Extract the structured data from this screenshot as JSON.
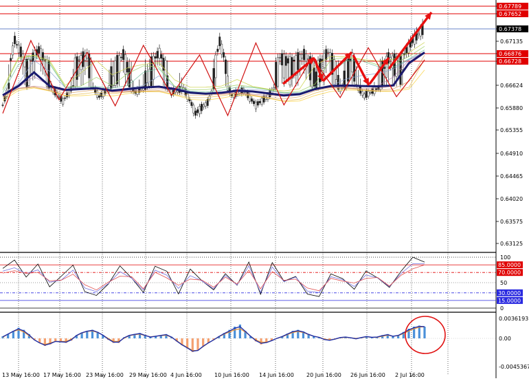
{
  "chart_data": [
    {
      "type": "candlestick",
      "title": "",
      "instrument_note": "",
      "y_ticks": [
        "0.67789",
        "0.67652",
        "0.67378",
        "0.67135",
        "0.66876",
        "0.66728",
        "0.66624",
        "0.65880",
        "0.65355",
        "0.64910",
        "0.64465",
        "0.64020",
        "0.63575",
        "0.63125"
      ],
      "ylim": [
        0.63,
        0.679
      ],
      "overlay_lines": [
        {
          "name": "",
          "price": 0.67789,
          "color": "#e00000",
          "tag_color": "#e00000"
        },
        {
          "name": "",
          "price": 0.67652,
          "color": "#e00000",
          "tag_color": "#e00000"
        },
        {
          "name": "",
          "price": 0.67378,
          "color": "#6a85c8",
          "tag_color": "#000000"
        },
        {
          "name": "",
          "price": 0.66876,
          "color": "#e00000",
          "tag_color": "#e00000"
        },
        {
          "name": "",
          "price": 0.66728,
          "color": "#e00000",
          "tag_color": "#e00000"
        }
      ],
      "zigzag_prices": [
        0.6575,
        0.6715,
        0.6615,
        0.669,
        0.6595,
        0.6705,
        0.663,
        0.6685,
        0.657,
        0.671,
        0.6598,
        0.668,
        0.6622,
        0.67,
        0.6625,
        0.6675
      ],
      "moving_average": [
        0.663,
        0.666,
        0.6668,
        0.666,
        0.6647,
        0.665,
        0.6653,
        0.6645,
        0.665,
        0.6655,
        0.6658,
        0.665,
        0.6638,
        0.6635,
        0.6638,
        0.6645,
        0.6642,
        0.6636,
        0.6629,
        0.6633,
        0.665,
        0.666,
        0.6662,
        0.666,
        0.6659,
        0.6662,
        0.6672,
        0.669
      ],
      "price_path": [
        0.6598,
        0.6715,
        0.6665,
        0.6695,
        0.6655,
        0.661,
        0.667,
        0.6685,
        0.6625,
        0.666,
        0.6685,
        0.664,
        0.666,
        0.669,
        0.664,
        0.6652,
        0.6575,
        0.6605,
        0.6712,
        0.663,
        0.6645,
        0.6598,
        0.6625,
        0.668,
        0.6672,
        0.6685,
        0.666,
        0.669,
        0.665,
        0.668,
        0.6628,
        0.665,
        0.668,
        0.6672,
        0.6715,
        0.674
      ],
      "arrow_color": "#e81010"
    },
    {
      "type": "line",
      "panel": "stochastic",
      "levels": [
        "100",
        "85.0000",
        "70.0000",
        "50",
        "30.0000",
        "15.0000",
        "0"
      ],
      "level_values": [
        100,
        85,
        70,
        50,
        30,
        15,
        0
      ],
      "ylim": [
        0,
        100
      ],
      "series": [
        {
          "name": "",
          "color": "#000000",
          "values": [
            78,
            95,
            60,
            88,
            40,
            65,
            82,
            35,
            22,
            50,
            80,
            62,
            28,
            85,
            70,
            30,
            75,
            55,
            35,
            68,
            45,
            90,
            28,
            88,
            55,
            60,
            30,
            20,
            70,
            55,
            40,
            70,
            62,
            38,
            75,
            98,
            92
          ]
        },
        {
          "name": "",
          "color": "#7070e0",
          "values": [
            70,
            82,
            65,
            78,
            48,
            58,
            72,
            42,
            30,
            50,
            70,
            60,
            35,
            75,
            65,
            38,
            65,
            52,
            40,
            62,
            48,
            80,
            34,
            78,
            55,
            58,
            36,
            28,
            64,
            54,
            44,
            64,
            60,
            42,
            68,
            88,
            86
          ]
        },
        {
          "name": "",
          "color": "#e05050",
          "values": [
            66,
            76,
            66,
            72,
            52,
            56,
            66,
            46,
            36,
            50,
            64,
            60,
            40,
            68,
            62,
            42,
            60,
            52,
            44,
            58,
            50,
            72,
            40,
            70,
            56,
            56,
            40,
            34,
            58,
            54,
            48,
            60,
            58,
            46,
            62,
            80,
            82
          ]
        }
      ]
    },
    {
      "type": "bar",
      "panel": "macd_histogram",
      "y_ticks": [
        "0.0036193",
        "0.00",
        "-0.0045367"
      ],
      "ylim": [
        -0.0045367,
        0.0036193
      ],
      "histogram": [
        0.4,
        0.8,
        1.4,
        2.0,
        1.6,
        0.8,
        -0.2,
        -0.6,
        -1.0,
        -0.8,
        -0.4,
        -0.5,
        -0.6,
        -0.3,
        0.6,
        1.1,
        1.4,
        1.6,
        1.2,
        0.6,
        -0.2,
        -0.6,
        -0.6,
        0.2,
        0.6,
        0.8,
        1.0,
        0.6,
        0.2,
        0.4,
        0.6,
        0.8,
        0.3,
        -0.4,
        -0.9,
        -1.3,
        -1.8,
        -1.6,
        -1.0,
        -0.6,
        -0.2,
        0.4,
        1.0,
        1.6,
        2.2,
        2.6,
        1.4,
        0.4,
        -0.4,
        -0.8,
        -0.6,
        -0.3,
        0.0,
        0.4,
        0.9,
        1.4,
        1.6,
        1.3,
        0.8,
        0.4,
        0.2,
        -0.2,
        -0.3,
        -0.1,
        0.2,
        0.3,
        0.1,
        -0.1,
        0.2,
        0.4,
        0.2,
        0.3,
        0.6,
        0.8,
        0.4,
        0.6,
        1.2,
        1.8,
        2.2,
        2.4,
        2.2
      ],
      "signal": [
        0.2,
        0.8,
        1.3,
        1.6,
        1.2,
        0.5,
        -0.2,
        -0.6,
        -0.8,
        -0.6,
        -0.4,
        -0.4,
        -0.4,
        -0.1,
        0.5,
        1.0,
        1.3,
        1.4,
        1.1,
        0.6,
        0.0,
        -0.4,
        -0.4,
        0.0,
        0.5,
        0.7,
        0.8,
        0.5,
        0.3,
        0.4,
        0.5,
        0.6,
        0.2,
        -0.3,
        -0.8,
        -1.2,
        -1.6,
        -1.6,
        -1.1,
        -0.6,
        -0.2,
        0.3,
        0.8,
        1.2,
        1.6,
        1.8,
        1.2,
        0.4,
        -0.2,
        -0.5,
        -0.5,
        -0.3,
        0.0,
        0.3,
        0.7,
        1.1,
        1.3,
        1.1,
        0.7,
        0.4,
        0.2,
        -0.1,
        -0.2,
        -0.1,
        0.1,
        0.2,
        0.1,
        0.0,
        0.1,
        0.3,
        0.2,
        0.2,
        0.4,
        0.6,
        0.4,
        0.5,
        0.9,
        1.4,
        1.8,
        2.1,
        2.2
      ],
      "positive_color": "#4a90d9",
      "negative_color": "#f4a070",
      "macd_line_color": "#1e2fa8",
      "signal_line_color": "#e89030",
      "highlight_circle_color": "#e01010"
    }
  ],
  "x_ticks": [
    "13 May 16:00",
    "17 May 16:00",
    "23 May 16:00",
    "29 May 16:00",
    "4 Jun 16:00",
    "10 Jun 16:00",
    "14 Jun 16:00",
    "20 Jun 16:00",
    "26 Jun 16:00",
    "2 Jul 16:00"
  ]
}
